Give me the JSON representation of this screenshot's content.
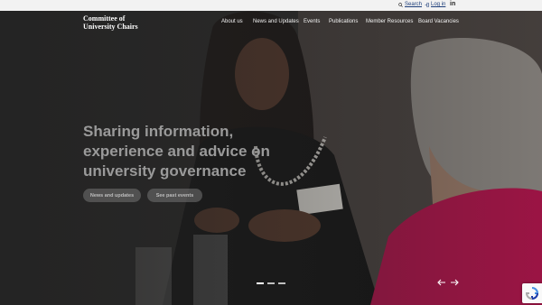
{
  "util_bar": {
    "search_label": "Search",
    "login_label": "Log in",
    "linkedin_label": "in"
  },
  "header": {
    "logo_line1": "Committee of",
    "logo_line2": "University Chairs",
    "nav": [
      {
        "label": "About us"
      },
      {
        "label": "News and Updates"
      },
      {
        "label": "Events"
      },
      {
        "label": "Publications"
      },
      {
        "label": "Member Resources"
      },
      {
        "label": "Board Vacancies"
      }
    ]
  },
  "hero": {
    "headline_line1": "Sharing information,",
    "headline_line2": "experience and advice on",
    "headline_line3": "university governance",
    "buttons": [
      {
        "label": "News and updates"
      },
      {
        "label": "See past events"
      }
    ],
    "slide_count": 3,
    "active_slide": 1
  },
  "colors": {
    "util_bar_bg": "#f2f2f2",
    "link": "#1f3f7a",
    "headline": "#9a9a9a",
    "accent_magenta": "#b0124a"
  },
  "icons": [
    "search-icon",
    "login-icon",
    "linkedin-icon",
    "arrow-left-icon",
    "arrow-right-icon",
    "recaptcha-icon"
  ]
}
